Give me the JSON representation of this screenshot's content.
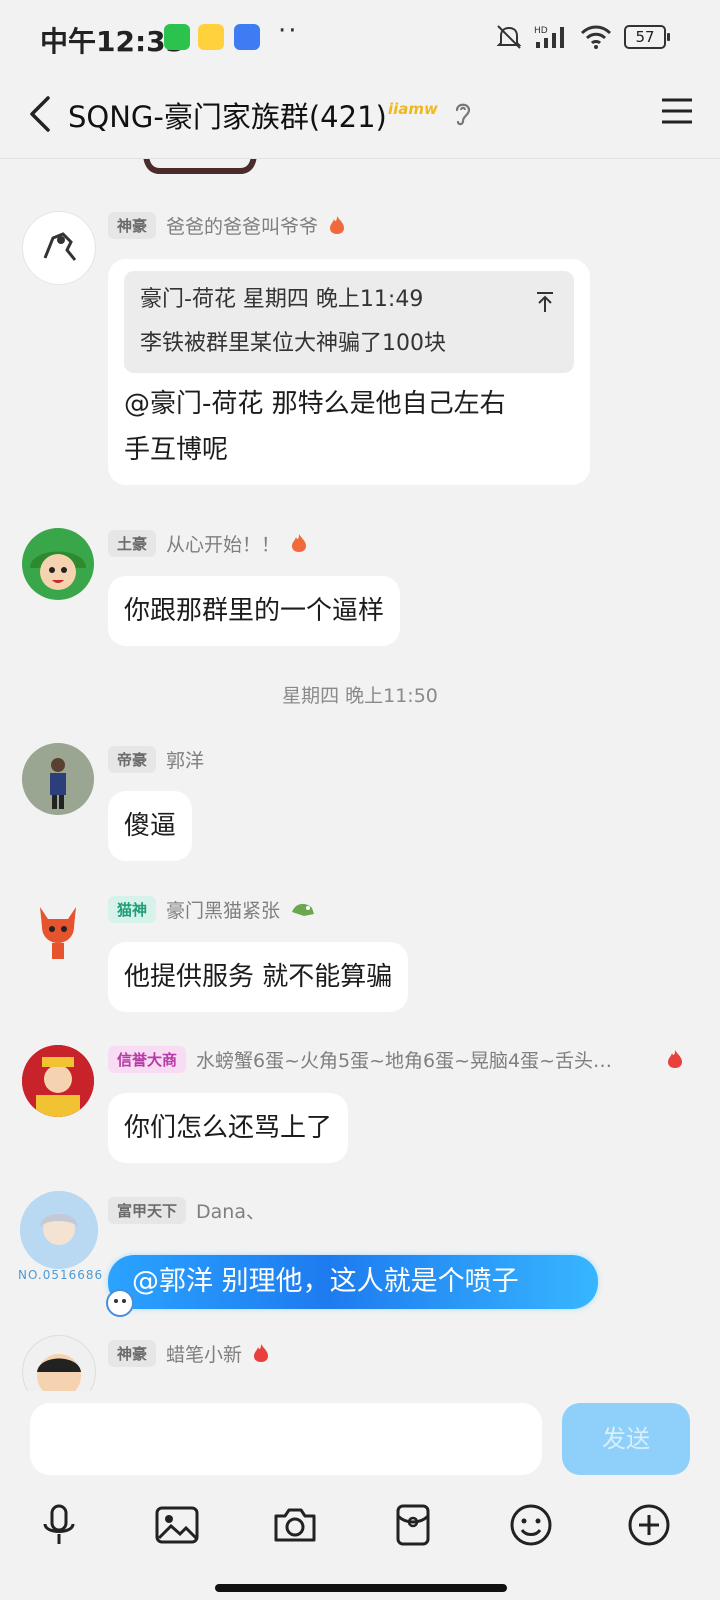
{
  "status_bar": {
    "time": "中午12:33",
    "battery": "57"
  },
  "header": {
    "title": "SQNG-豪门家族群(421)",
    "vip_badge": "iiamw"
  },
  "messages": [
    {
      "tag": "神豪",
      "sender": "爸爸的爸爸叫爷爷",
      "quote_header": "豪门-荷花  星期四 晚上11:49",
      "quote_text": "李铁被群里某位大神骗了100块",
      "text_line1": "@豪门-荷花  那特么是他自己左右",
      "text_line2": "手互博呢"
    },
    {
      "tag": "土豪",
      "sender": "从心开始！！",
      "text": "你跟那群里的一个逼样"
    },
    {
      "divider": "星期四 晚上11:50"
    },
    {
      "tag": "帝豪",
      "sender": "郭洋",
      "text": "傻逼"
    },
    {
      "tag": "猫神",
      "sender": "豪门黑猫紧张",
      "text": "他提供服务 就不能算骗"
    },
    {
      "tag": "信誉大商",
      "sender": "水螃蟹6蛋~火角5蛋~地角6蛋~晃脑4蛋~舌头…",
      "text": "你们怎么还骂上了"
    },
    {
      "tag": "富甲天下",
      "sender": "Dana、",
      "text": "@郭洋 别理他，这人就是个喷子",
      "avatar_caption": "NO.0516686"
    },
    {
      "tag": "神豪",
      "sender": "蜡笔小新"
    }
  ],
  "input": {
    "send_label": "发送"
  },
  "toolbar_icons": [
    "microphone-icon",
    "image-icon",
    "camera-icon",
    "red-packet-icon",
    "emoji-icon",
    "plus-icon"
  ]
}
